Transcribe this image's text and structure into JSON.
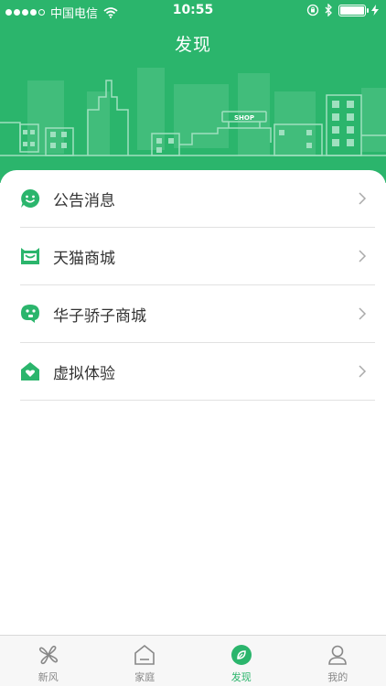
{
  "status_bar": {
    "carrier": "中国电信",
    "time": "10:55"
  },
  "header": {
    "title": "发现",
    "shop_sign": "SHOP"
  },
  "menu": {
    "items": [
      {
        "label": "公告消息",
        "icon": "chat-smile-icon"
      },
      {
        "label": "天猫商城",
        "icon": "tmall-cat-icon"
      },
      {
        "label": "华子骄子商城",
        "icon": "mascot-icon"
      },
      {
        "label": "虚拟体验",
        "icon": "house-heart-icon"
      }
    ]
  },
  "tabbar": {
    "tabs": [
      {
        "label": "新风",
        "icon": "fan-icon",
        "active": false
      },
      {
        "label": "家庭",
        "icon": "home-icon",
        "active": false
      },
      {
        "label": "发现",
        "icon": "compass-leaf-icon",
        "active": true
      },
      {
        "label": "我的",
        "icon": "person-icon",
        "active": false
      }
    ]
  },
  "colors": {
    "brand_green": "#2bb56c",
    "inactive_gray": "#888888"
  }
}
